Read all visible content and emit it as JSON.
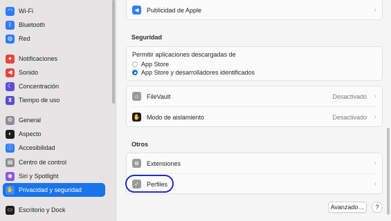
{
  "sidebar": {
    "items": [
      {
        "label": "Wi-Fi",
        "icon": "wifi-icon",
        "icon_glyph": "◠",
        "color": "#2f7cf6"
      },
      {
        "label": "Bluetooth",
        "icon": "bluetooth-icon",
        "icon_glyph": "ᛒ",
        "color": "#2f7cf6"
      },
      {
        "label": "Red",
        "icon": "globe-icon",
        "icon_glyph": "◍",
        "color": "#2f7cf6"
      },
      {
        "label": "Notificaciones",
        "icon": "bell-icon",
        "icon_glyph": "●",
        "color": "#e8453c"
      },
      {
        "label": "Sonido",
        "icon": "speaker-icon",
        "icon_glyph": "◀",
        "color": "#e8453c"
      },
      {
        "label": "Concentración",
        "icon": "moon-icon",
        "icon_glyph": "☾",
        "color": "#5a4fcf"
      },
      {
        "label": "Tiempo de uso",
        "icon": "hourglass-icon",
        "icon_glyph": "⧗",
        "color": "#5a4fcf"
      },
      {
        "label": "General",
        "icon": "gear-icon",
        "icon_glyph": "⚙",
        "color": "#8e8e93"
      },
      {
        "label": "Aspecto",
        "icon": "appearance-icon",
        "icon_glyph": "◐",
        "color": "#1c1c1e"
      },
      {
        "label": "Accesibilidad",
        "icon": "accessibility-icon",
        "icon_glyph": "ⓘ",
        "color": "#2f7cf6"
      },
      {
        "label": "Centro de control",
        "icon": "control-center-icon",
        "icon_glyph": "▤",
        "color": "#8e8e93"
      },
      {
        "label": "Siri y Spotlight",
        "icon": "siri-icon",
        "icon_glyph": "◉",
        "color": "#8b55e0"
      },
      {
        "label": "Privacidad y seguridad",
        "icon": "hand-icon",
        "icon_glyph": "✋",
        "color": "#2f7cf6"
      },
      {
        "label": "Escritorio y Dock",
        "icon": "dock-icon",
        "icon_glyph": "▭",
        "color": "#1c1c1e"
      }
    ]
  },
  "main": {
    "top_row": {
      "label": "Publicidad de Apple",
      "icon": "megaphone-icon",
      "icon_glyph": "◀",
      "color": "#2f7cf6"
    },
    "security": {
      "title": "Seguridad",
      "allow_label": "Permitir aplicaciones descargadas de",
      "options": [
        {
          "label": "App Store",
          "selected": false
        },
        {
          "label": "App Store y desarrolladores identificados",
          "selected": true
        }
      ],
      "rows": [
        {
          "label": "FileVault",
          "value": "Desactivado",
          "icon": "filevault-icon",
          "icon_glyph": "⌂",
          "color": "#9a9a9a"
        },
        {
          "label": "Modo de aislamiento",
          "value": "Desactivado",
          "icon": "lockdown-hand-icon",
          "icon_glyph": "✋",
          "color": "#1c1c1e"
        }
      ]
    },
    "others": {
      "title": "Otros",
      "rows": [
        {
          "label": "Extensiones",
          "icon": "extensions-icon",
          "icon_glyph": "⧉",
          "color": "#9a9a9a"
        },
        {
          "label": "Perfiles",
          "icon": "profiles-icon",
          "icon_glyph": "✓",
          "color": "#9a9a9a"
        }
      ]
    },
    "advanced_button": "Avanzado…",
    "help_button": "?"
  },
  "colors": {
    "accent": "#1a73e8",
    "highlight_ring": "#1d2ec4"
  }
}
